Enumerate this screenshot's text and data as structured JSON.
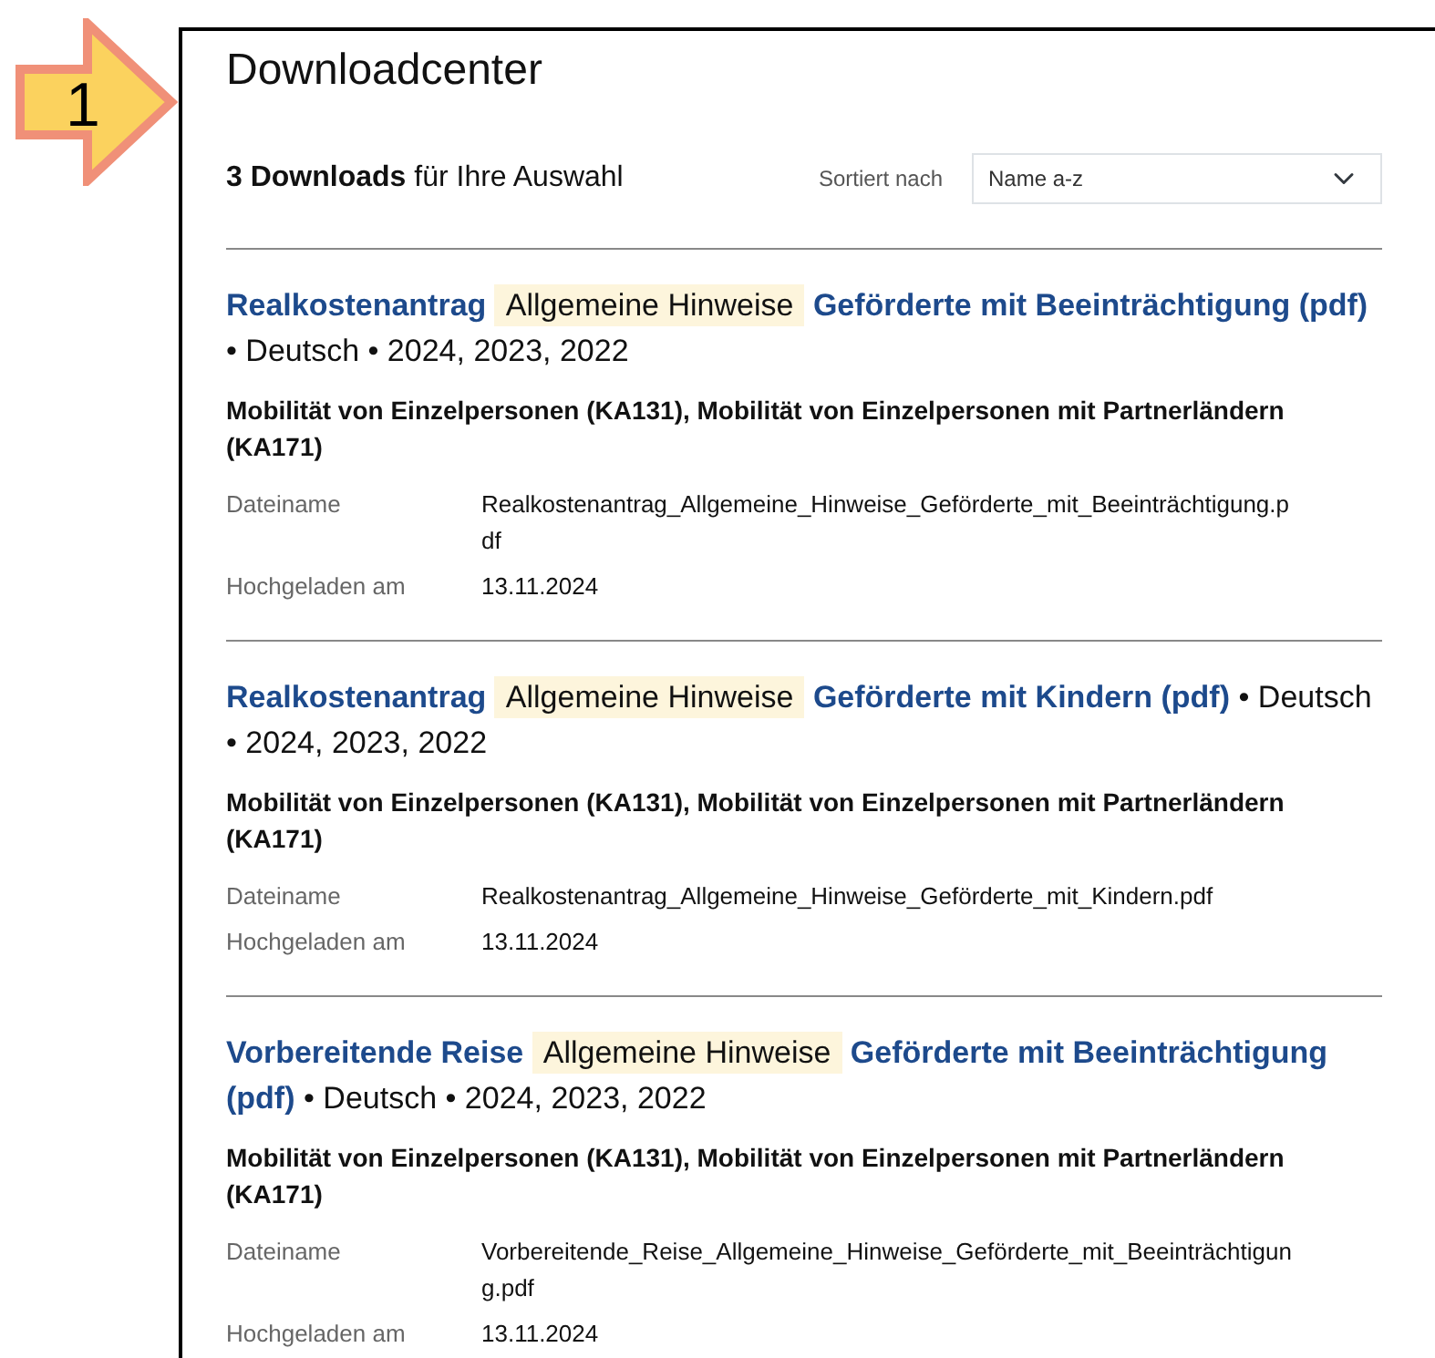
{
  "callout": {
    "number": "1"
  },
  "title": "Downloadcenter",
  "summary": "**3 Downloads** für Ihre Auswahl",
  "sort": {
    "label": "Sortiert nach",
    "value": "Name a-z"
  },
  "downloads": [
    {
      "title_parts": [
        {
          "text": "Realkostenantrag",
          "highlighted": false
        },
        {
          "text": "Allgemeine Hinweise",
          "highlighted": true
        },
        {
          "text": "Geförderte mit Beeinträchtigung (pdf)",
          "highlighted": false
        }
      ],
      "meta": "• Deutsch • 2024, 2023, 2022",
      "programs": "Mobilität von Einzelpersonen (KA131), Mobilität von Einzelpersonen mit Partnerländern (KA171)",
      "fields": [
        {
          "label": "Dateiname",
          "value": "Realkostenantrag_Allgemeine_Hinweise_Geförderte_mit_Beeinträchtigung.pdf"
        },
        {
          "label": "Hochgeladen am",
          "value": "13.11.2024"
        }
      ]
    },
    {
      "title_parts": [
        {
          "text": "Realkostenantrag",
          "highlighted": false
        },
        {
          "text": "Allgemeine Hinweise",
          "highlighted": true
        },
        {
          "text": "Geförderte mit Kindern (pdf)",
          "highlighted": false
        }
      ],
      "meta": "• Deutsch • 2024, 2023, 2022",
      "programs": "Mobilität von Einzelpersonen (KA131), Mobilität von Einzelpersonen mit Partnerländern (KA171)",
      "fields": [
        {
          "label": "Dateiname",
          "value": "Realkostenantrag_Allgemeine_Hinweise_Geförderte_mit_Kindern.pdf"
        },
        {
          "label": "Hochgeladen am",
          "value": "13.11.2024"
        }
      ]
    },
    {
      "title_parts": [
        {
          "text": "Vorbereitende Reise",
          "highlighted": false
        },
        {
          "text": "Allgemeine Hinweise",
          "highlighted": true
        },
        {
          "text": "Geförderte mit Beeinträchtigung (pdf)",
          "highlighted": false
        }
      ],
      "meta": "• Deutsch • 2024, 2023, 2022",
      "programs": "Mobilität von Einzelpersonen (KA131), Mobilität von Einzelpersonen mit Partnerländern (KA171)",
      "fields": [
        {
          "label": "Dateiname",
          "value": "Vorbereitende_Reise_Allgemeine_Hinweise_Geförderte_mit_Beeinträchtigung.pdf"
        },
        {
          "label": "Hochgeladen am",
          "value": "13.11.2024"
        }
      ]
    }
  ]
}
